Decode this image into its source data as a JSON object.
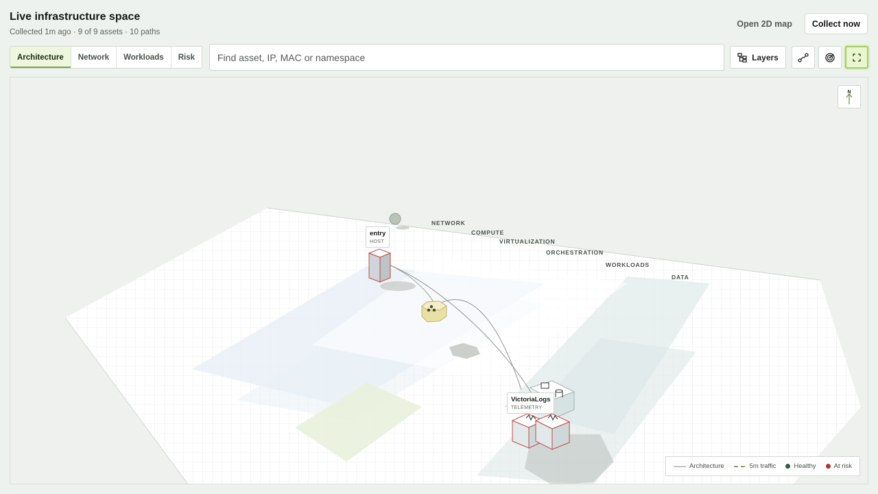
{
  "header": {
    "title": "Live infrastructure space",
    "subtitle": "Collected 1m ago · 9 of 9 assets · 10 paths",
    "open_map_label": "Open 2D map",
    "collect_label": "Collect now"
  },
  "toolbar": {
    "tabs": [
      {
        "label": "Architecture",
        "active": true
      },
      {
        "label": "Network",
        "active": false
      },
      {
        "label": "Workloads",
        "active": false
      },
      {
        "label": "Risk",
        "active": false
      }
    ],
    "search": {
      "placeholder": "Find asset, IP, MAC or namespace",
      "value": ""
    },
    "layers_label": "Layers",
    "icon_buttons": [
      "route-icon",
      "target-icon",
      "fullscreen-icon"
    ]
  },
  "map": {
    "compass_label": "N",
    "layers": [
      "NETWORK",
      "COMPUTE",
      "VIRTUALIZATION",
      "ORCHESTRATION",
      "WORKLOADS",
      "DATA"
    ],
    "assets": [
      {
        "name": "entry",
        "kind": "HOST"
      },
      {
        "name": "VictoriaLogs",
        "kind": "TELEMETRY"
      }
    ]
  },
  "legend": [
    {
      "label": "Architecture",
      "type": "line",
      "color": "#9aa09a"
    },
    {
      "label": "5m traffic",
      "type": "dashed",
      "color": "#6b7d2b"
    },
    {
      "label": "Healthy",
      "type": "dot",
      "color": "#2e5e3e"
    },
    {
      "label": "At risk",
      "type": "dot",
      "color": "#b5302a"
    }
  ],
  "colors": {
    "accent": "#7aa43c",
    "risk": "#b5302a",
    "healthy": "#2e5e3e"
  }
}
